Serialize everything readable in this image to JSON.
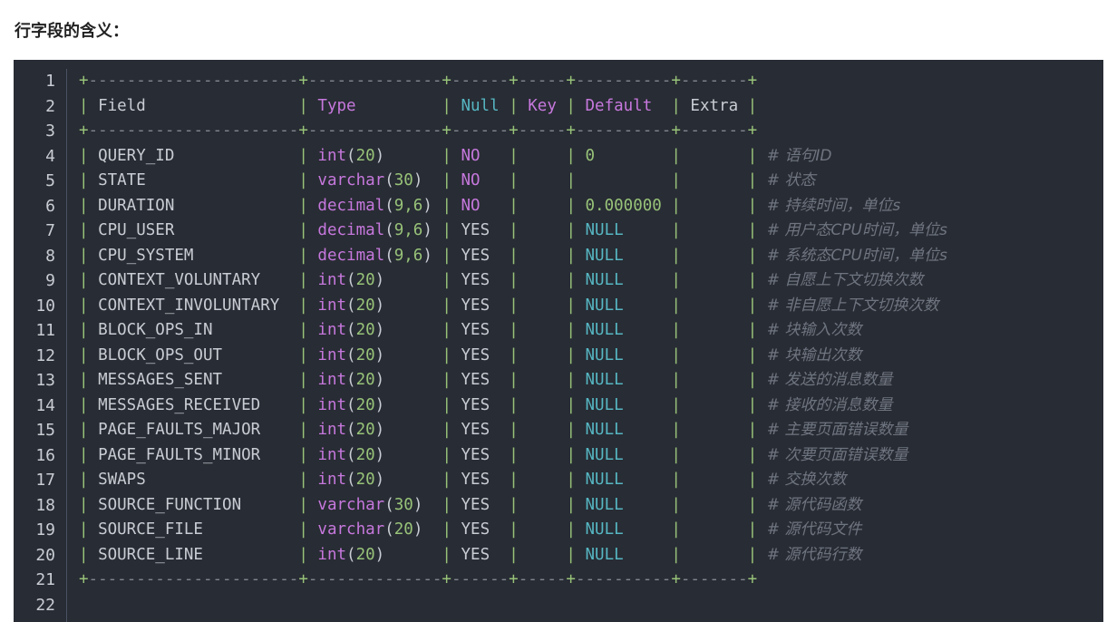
{
  "heading": "行字段的含义：",
  "code": {
    "line_numbers": [
      "1",
      "2",
      "3",
      "4",
      "5",
      "6",
      "7",
      "8",
      "9",
      "10",
      "11",
      "12",
      "13",
      "14",
      "15",
      "16",
      "17",
      "18",
      "19",
      "20",
      "21",
      "22"
    ],
    "border": "+----------------------+--------------+------+-----+----------+-------+",
    "header": {
      "field": "Field",
      "type": "Type",
      "null": "Null",
      "key": "Key",
      "default": "Default",
      "extra": "Extra"
    },
    "rows": [
      {
        "field": "QUERY_ID",
        "type_kw": "int",
        "type_args": "20",
        "null": "NO",
        "default": "0",
        "comment": "# 语句ID"
      },
      {
        "field": "STATE",
        "type_kw": "varchar",
        "type_args": "30",
        "null": "NO",
        "default": "",
        "comment": "# 状态"
      },
      {
        "field": "DURATION",
        "type_kw": "decimal",
        "type_args": "9,6",
        "null": "NO",
        "default": "0.000000",
        "comment": "# 持续时间，单位s"
      },
      {
        "field": "CPU_USER",
        "type_kw": "decimal",
        "type_args": "9,6",
        "null": "YES",
        "default": "NULL",
        "comment": "# 用户态CPU时间，单位s"
      },
      {
        "field": "CPU_SYSTEM",
        "type_kw": "decimal",
        "type_args": "9,6",
        "null": "YES",
        "default": "NULL",
        "comment": "# 系统态CPU时间，单位s"
      },
      {
        "field": "CONTEXT_VOLUNTARY",
        "type_kw": "int",
        "type_args": "20",
        "null": "YES",
        "default": "NULL",
        "comment": "# 自愿上下文切换次数"
      },
      {
        "field": "CONTEXT_INVOLUNTARY",
        "type_kw": "int",
        "type_args": "20",
        "null": "YES",
        "default": "NULL",
        "comment": "# 非自愿上下文切换次数"
      },
      {
        "field": "BLOCK_OPS_IN",
        "type_kw": "int",
        "type_args": "20",
        "null": "YES",
        "default": "NULL",
        "comment": "# 块输入次数"
      },
      {
        "field": "BLOCK_OPS_OUT",
        "type_kw": "int",
        "type_args": "20",
        "null": "YES",
        "default": "NULL",
        "comment": "# 块输出次数"
      },
      {
        "field": "MESSAGES_SENT",
        "type_kw": "int",
        "type_args": "20",
        "null": "YES",
        "default": "NULL",
        "comment": "# 发送的消息数量"
      },
      {
        "field": "MESSAGES_RECEIVED",
        "type_kw": "int",
        "type_args": "20",
        "null": "YES",
        "default": "NULL",
        "comment": "# 接收的消息数量"
      },
      {
        "field": "PAGE_FAULTS_MAJOR",
        "type_kw": "int",
        "type_args": "20",
        "null": "YES",
        "default": "NULL",
        "comment": "# 主要页面错误数量"
      },
      {
        "field": "PAGE_FAULTS_MINOR",
        "type_kw": "int",
        "type_args": "20",
        "null": "YES",
        "default": "NULL",
        "comment": "# 次要页面错误数量"
      },
      {
        "field": "SWAPS",
        "type_kw": "int",
        "type_args": "20",
        "null": "YES",
        "default": "NULL",
        "comment": "# 交换次数"
      },
      {
        "field": "SOURCE_FUNCTION",
        "type_kw": "varchar",
        "type_args": "30",
        "null": "YES",
        "default": "NULL",
        "comment": "# 源代码函数"
      },
      {
        "field": "SOURCE_FILE",
        "type_kw": "varchar",
        "type_args": "20",
        "null": "YES",
        "default": "NULL",
        "comment": "# 源代码文件"
      },
      {
        "field": "SOURCE_LINE",
        "type_kw": "int",
        "type_args": "20",
        "null": "YES",
        "default": "NULL",
        "comment": "# 源代码行数"
      }
    ]
  },
  "colors": {
    "background": "#282c34",
    "keyword": "#c678dd",
    "number": "#98c379",
    "null": "#56b6c2",
    "comment": "#6f7580"
  }
}
